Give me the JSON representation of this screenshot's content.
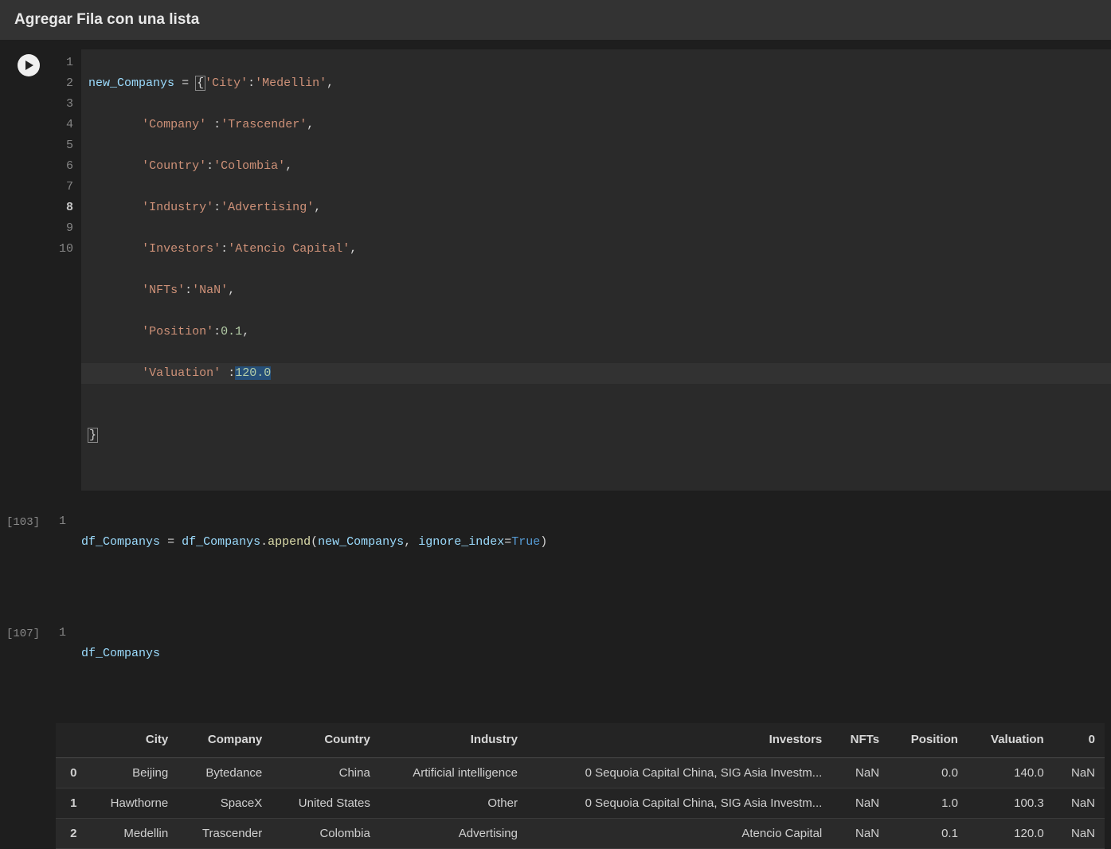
{
  "header": {
    "title": "Agregar Fila con una lista"
  },
  "cell1": {
    "exec_label": "",
    "lines": [
      "1",
      "2",
      "3",
      "4",
      "5",
      "6",
      "7",
      "8",
      "9",
      "10"
    ],
    "code": {
      "l1_var": "new_Companys",
      "l1_op": " = ",
      "l1_brace": "{",
      "l1_k": "'City'",
      "l1_c": ":",
      "l1_v": "'Medellin'",
      "l1_comma": ",",
      "l2_k": "'Company'",
      "l2_sp": " ",
      "l2_c": ":",
      "l2_v": "'Trascender'",
      "l2_comma": ",",
      "l3_k": "'Country'",
      "l3_c": ":",
      "l3_v": "'Colombia'",
      "l3_comma": ",",
      "l4_k": "'Industry'",
      "l4_c": ":",
      "l4_v": "'Advertising'",
      "l4_comma": ",",
      "l5_k": "'Investors'",
      "l5_c": ":",
      "l5_v": "'Atencio Capital'",
      "l5_comma": ",",
      "l6_k": "'NFTs'",
      "l6_c": ":",
      "l6_v": "'NaN'",
      "l6_comma": ",",
      "l7_k": "'Position'",
      "l7_c": ":",
      "l7_v": "0.1",
      "l7_comma": ",",
      "l8_k": "'Valuation'",
      "l8_sp": " ",
      "l8_c": ":",
      "l8_v": "120.0",
      "l10_brace": "}"
    }
  },
  "cell2": {
    "exec_label": "[103]",
    "line_no": "1",
    "code": {
      "pfx": " ",
      "var1": "df_Companys",
      "op": " = ",
      "var2": "df_Companys",
      "dot": ".",
      "func": "append",
      "open": "(",
      "arg1": "new_Companys",
      "comma": ", ",
      "kw": "ignore_index",
      "eq": "=",
      "bool": "True",
      "close": ")"
    }
  },
  "cell3": {
    "exec_label": "[107]",
    "line_no": "1",
    "code": {
      "pfx": " ",
      "var": "df_Companys"
    }
  },
  "table": {
    "headers": [
      "",
      "City",
      "Company",
      "Country",
      "Industry",
      "Investors",
      "NFTs",
      "Position",
      "Valuation",
      "0"
    ],
    "rows": [
      {
        "idx": "0",
        "City": "Beijing",
        "Company": "Bytedance",
        "Country": "China",
        "Industry": "Artificial intelligence",
        "Investors": "0 Sequoia Capital China, SIG Asia Investm...",
        "NFTs": "NaN",
        "Position": "0.0",
        "Valuation": "140.0",
        "zero": "NaN"
      },
      {
        "idx": "1",
        "City": "Hawthorne",
        "Company": "SpaceX",
        "Country": "United States",
        "Industry": "Other",
        "Investors": "0 Sequoia Capital China, SIG Asia Investm...",
        "NFTs": "NaN",
        "Position": "1.0",
        "Valuation": "100.3",
        "zero": "NaN"
      },
      {
        "idx": "2",
        "City": "Medellin",
        "Company": "Trascender",
        "Country": "Colombia",
        "Industry": "Advertising",
        "Investors": "Atencio Capital",
        "NFTs": "NaN",
        "Position": "0.1",
        "Valuation": "120.0",
        "zero": "NaN"
      }
    ]
  }
}
